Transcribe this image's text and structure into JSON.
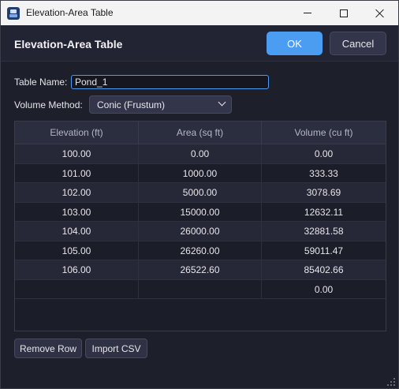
{
  "window": {
    "title": "Elevation-Area Table"
  },
  "header": {
    "title": "Elevation-Area Table",
    "ok_label": "OK",
    "cancel_label": "Cancel"
  },
  "form": {
    "table_name_label": "Table Name:",
    "table_name_value": "Pond_1",
    "volume_method_label": "Volume Method:",
    "volume_method_value": "Conic (Frustum)"
  },
  "table": {
    "headers": [
      "Elevation (ft)",
      "Area (sq ft)",
      "Volume (cu ft)"
    ],
    "rows": [
      [
        "100.00",
        "0.00",
        "0.00"
      ],
      [
        "101.00",
        "1000.00",
        "333.33"
      ],
      [
        "102.00",
        "5000.00",
        "3078.69"
      ],
      [
        "103.00",
        "15000.00",
        "12632.11"
      ],
      [
        "104.00",
        "26000.00",
        "32881.58"
      ],
      [
        "105.00",
        "26260.00",
        "59011.47"
      ],
      [
        "106.00",
        "26522.60",
        "85402.66"
      ],
      [
        "",
        "",
        "0.00"
      ]
    ]
  },
  "footer": {
    "remove_row_label": "Remove Row",
    "import_csv_label": "Import CSV"
  },
  "colors": {
    "accent": "#4a9df0",
    "background": "#1d1f2b"
  }
}
